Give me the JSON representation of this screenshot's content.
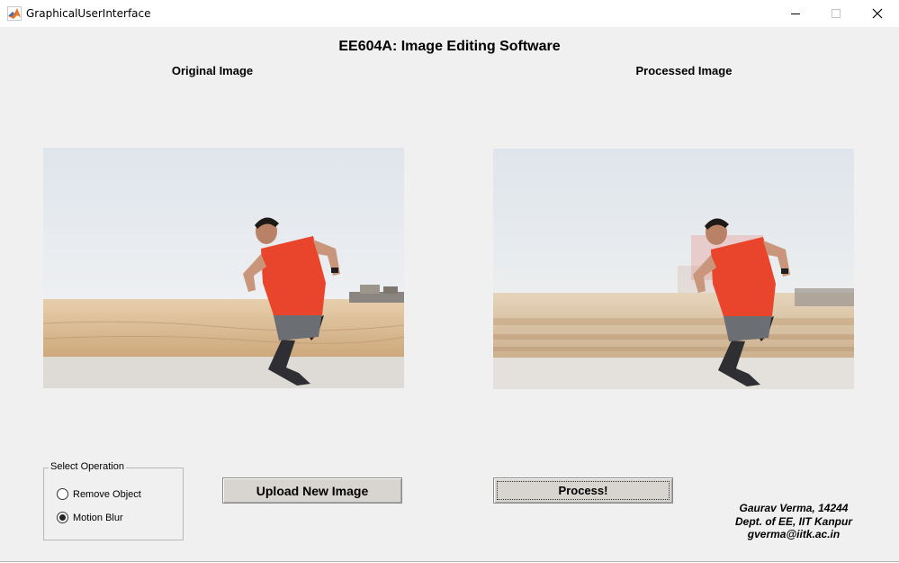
{
  "window": {
    "title": "GraphicalUserInterface",
    "icon": "matlab-icon"
  },
  "figure": {
    "title": "EE604A: Image Editing Software",
    "original_panel_title": "Original Image",
    "processed_panel_title": "Processed Image"
  },
  "operation_group": {
    "title": "Select Operation",
    "options": [
      {
        "label": "Remove Object",
        "selected": false
      },
      {
        "label": "Motion Blur",
        "selected": true
      }
    ]
  },
  "buttons": {
    "upload_label": "Upload New Image",
    "process_label": "Process!"
  },
  "author": {
    "line1": "Gaurav Verma, 14244",
    "line2": "Dept. of EE, IIT Kanpur",
    "line3": "gverma@iitk.ac.in"
  },
  "colors": {
    "figure_background": "#f0f0f0",
    "button_face": "#d8d4cf",
    "shirt": "#e8452c",
    "sky": "#e3e8ee",
    "sand": "#d9bb94"
  }
}
